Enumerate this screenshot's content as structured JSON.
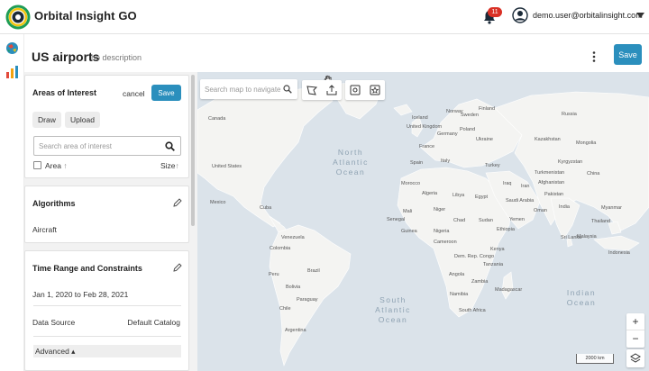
{
  "header": {
    "brand": "Orbital Insight GO",
    "notification_count": "11",
    "user_email": "demo.user@orbitalinsight.com"
  },
  "project": {
    "title": "US airports",
    "description": "no description",
    "save_label": "Save"
  },
  "aoi": {
    "title": "Areas of Interest",
    "cancel_label": "cancel",
    "save_label": "Save",
    "draw_label": "Draw",
    "upload_label": "Upload",
    "search_placeholder": "Search area of interest",
    "col_area": "Area",
    "col_size": "Size"
  },
  "algorithms": {
    "title": "Algorithms",
    "value": "Aircraft"
  },
  "time_range": {
    "title": "Time Range and Constraints",
    "dates": "Jan 1, 2020 to Feb 28, 2021",
    "data_source_label": "Data Source",
    "data_source_value": "Default Catalog",
    "advanced_label": "Advanced ▴"
  },
  "map": {
    "search_placeholder": "Search map to navigate",
    "scale": "2000 km",
    "countries": [
      "Canada",
      "United States",
      "Mexico",
      "Cuba",
      "Venezuela",
      "Colombia",
      "Brazil",
      "Peru",
      "Bolivia",
      "Paraguay",
      "Chile",
      "Argentina",
      "Iceland",
      "Norway",
      "Sweden",
      "Finland",
      "United Kingdom",
      "Poland",
      "Germany",
      "Ukraine",
      "France",
      "Spain",
      "Italy",
      "Turkey",
      "Morocco",
      "Algeria",
      "Libya",
      "Egypt",
      "Mali",
      "Niger",
      "Chad",
      "Sudan",
      "Nigeria",
      "Ethiopia",
      "Senegal",
      "Guinea",
      "Cameroon",
      "Kenya",
      "Dem. Rep. Congo",
      "Tanzania",
      "Angola",
      "Zambia",
      "Namibia",
      "Madagascar",
      "South Africa",
      "Saudi Arabia",
      "Iraq",
      "Iran",
      "Afghanistan",
      "Pakistan",
      "India",
      "Yemen",
      "Oman",
      "Kazakhstan",
      "Russia",
      "Mongolia",
      "China",
      "Kyrgyzstan",
      "Myanmar",
      "Thailand",
      "Sri Lanka",
      "Malaysia",
      "Indonesia",
      "Turkmenistan",
      "Finland"
    ],
    "ocean_north": "North Atlantic Ocean",
    "ocean_south": "South Atlantic Ocean",
    "ocean_indian": "Indian Ocean"
  },
  "colors": {
    "accent": "#2b8fbd",
    "badge": "#d93025",
    "water": "#dbe3ea",
    "land": "#f4f4f2"
  }
}
